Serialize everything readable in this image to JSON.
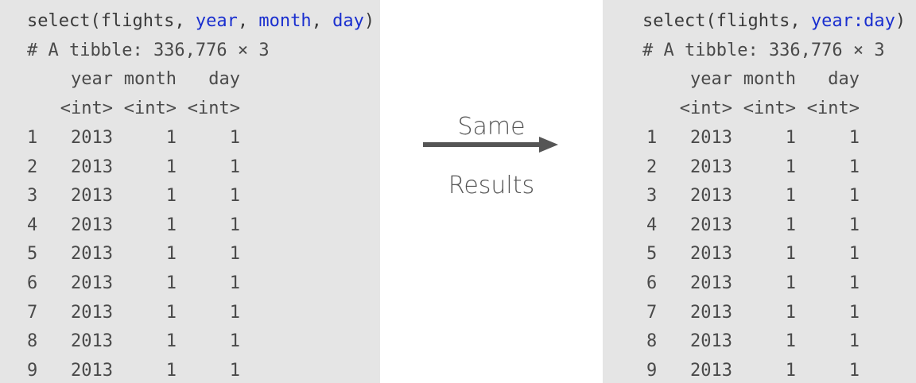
{
  "left": {
    "cmd": {
      "fn": "select(flights, ",
      "a1": "year",
      "s1": ", ",
      "a2": "month",
      "s2": ", ",
      "a3": "day",
      "end": ")"
    },
    "tibble_info": "# A tibble: 336,776 × 3",
    "headers": [
      "year",
      "month",
      "day"
    ],
    "types": [
      "<int>",
      "<int>",
      "<int>"
    ],
    "rows": [
      [
        "1",
        "2013",
        "1",
        "1"
      ],
      [
        "2",
        "2013",
        "1",
        "1"
      ],
      [
        "3",
        "2013",
        "1",
        "1"
      ],
      [
        "4",
        "2013",
        "1",
        "1"
      ],
      [
        "5",
        "2013",
        "1",
        "1"
      ],
      [
        "6",
        "2013",
        "1",
        "1"
      ],
      [
        "7",
        "2013",
        "1",
        "1"
      ],
      [
        "8",
        "2013",
        "1",
        "1"
      ],
      [
        "9",
        "2013",
        "1",
        "1"
      ]
    ]
  },
  "middle": {
    "top_label": "Same",
    "bottom_label": "Results",
    "arrow_color": "#555555"
  },
  "right": {
    "cmd": {
      "fn": "select(flights, ",
      "range": "year:day",
      "end": ")"
    },
    "tibble_info": "# A tibble: 336,776 × 3",
    "headers": [
      "year",
      "month",
      "day"
    ],
    "types": [
      "<int>",
      "<int>",
      "<int>"
    ],
    "rows": [
      [
        "1",
        "2013",
        "1",
        "1"
      ],
      [
        "2",
        "2013",
        "1",
        "1"
      ],
      [
        "3",
        "2013",
        "1",
        "1"
      ],
      [
        "4",
        "2013",
        "1",
        "1"
      ],
      [
        "5",
        "2013",
        "1",
        "1"
      ],
      [
        "6",
        "2013",
        "1",
        "1"
      ],
      [
        "7",
        "2013",
        "1",
        "1"
      ],
      [
        "8",
        "2013",
        "1",
        "1"
      ],
      [
        "9",
        "2013",
        "1",
        "1"
      ]
    ]
  },
  "colors": {
    "panel_bg": "#e5e5e5",
    "keyword_blue": "#1a2fcf",
    "text_gray": "#4a4a4a"
  }
}
